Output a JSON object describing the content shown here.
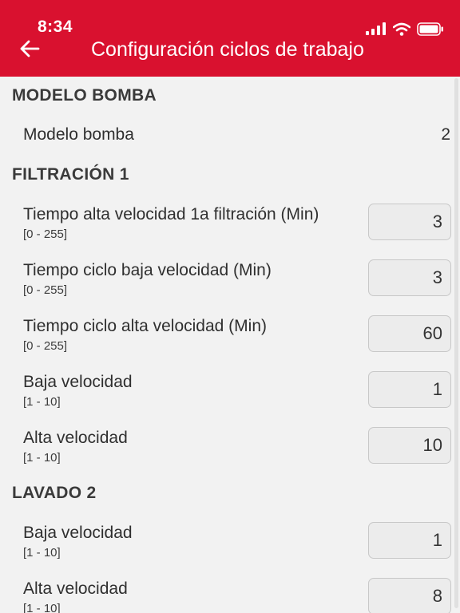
{
  "status_bar": {
    "time": "8:34"
  },
  "header": {
    "title": "Configuración ciclos de trabajo"
  },
  "sections": {
    "modelo": {
      "title": "MODELO BOMBA",
      "label": "Modelo bomba",
      "value": "2"
    },
    "filtracion": {
      "title": "FILTRACIÓN 1",
      "items": [
        {
          "label": "Tiempo alta velocidad 1a filtración (Min)",
          "range": "[0 - 255]",
          "value": "3"
        },
        {
          "label": "Tiempo ciclo baja velocidad (Min)",
          "range": "[0 - 255]",
          "value": "3"
        },
        {
          "label": "Tiempo ciclo alta velocidad (Min)",
          "range": "[0 - 255]",
          "value": "60"
        },
        {
          "label": "Baja velocidad",
          "range": "[1 - 10]",
          "value": "1"
        },
        {
          "label": "Alta velocidad",
          "range": "[1 - 10]",
          "value": "10"
        }
      ]
    },
    "lavado": {
      "title": "LAVADO 2",
      "items": [
        {
          "label": "Baja velocidad",
          "range": "[1 - 10]",
          "value": "1"
        },
        {
          "label": "Alta velocidad",
          "range": "[1 - 10]",
          "value": "8"
        }
      ]
    }
  },
  "colors": {
    "header_bg": "#d9112f",
    "page_bg": "#f2f2f2"
  },
  "icons": [
    "back-arrow-icon",
    "signal-icon",
    "wifi-icon",
    "battery-icon"
  ]
}
